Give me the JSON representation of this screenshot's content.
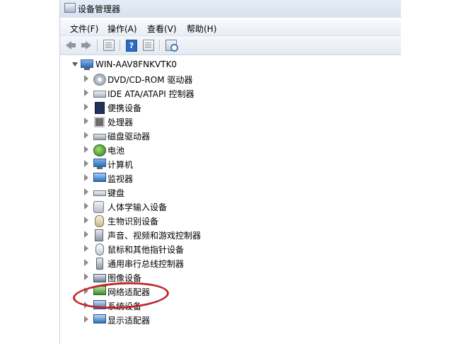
{
  "window": {
    "title": "设备管理器"
  },
  "menu": [
    "文件(F)",
    "操作(A)",
    "查看(V)",
    "帮助(H)"
  ],
  "toolbar": {
    "back_icon": "back-arrow-icon",
    "forward_icon": "forward-arrow-icon",
    "properties_icon": "properties-icon",
    "help_icon": "help-icon",
    "help_glyph": "?",
    "view_icon": "view-icon",
    "scan_icon": "scan-hardware-icon"
  },
  "tree": {
    "root": "WIN-AAV8FNKVTK0",
    "items": [
      "DVD/CD-ROM 驱动器",
      "IDE ATA/ATAPI 控制器",
      "便携设备",
      "处理器",
      "磁盘驱动器",
      "电池",
      "计算机",
      "监视器",
      "键盘",
      "人体学输入设备",
      "生物识别设备",
      "声音、视频和游戏控制器",
      "鼠标和其他指针设备",
      "通用串行总线控制器",
      "图像设备",
      "网络适配器",
      "系统设备",
      "显示适配器"
    ]
  },
  "annotation": {
    "color": "#c1272d",
    "target": "网络适配器"
  }
}
